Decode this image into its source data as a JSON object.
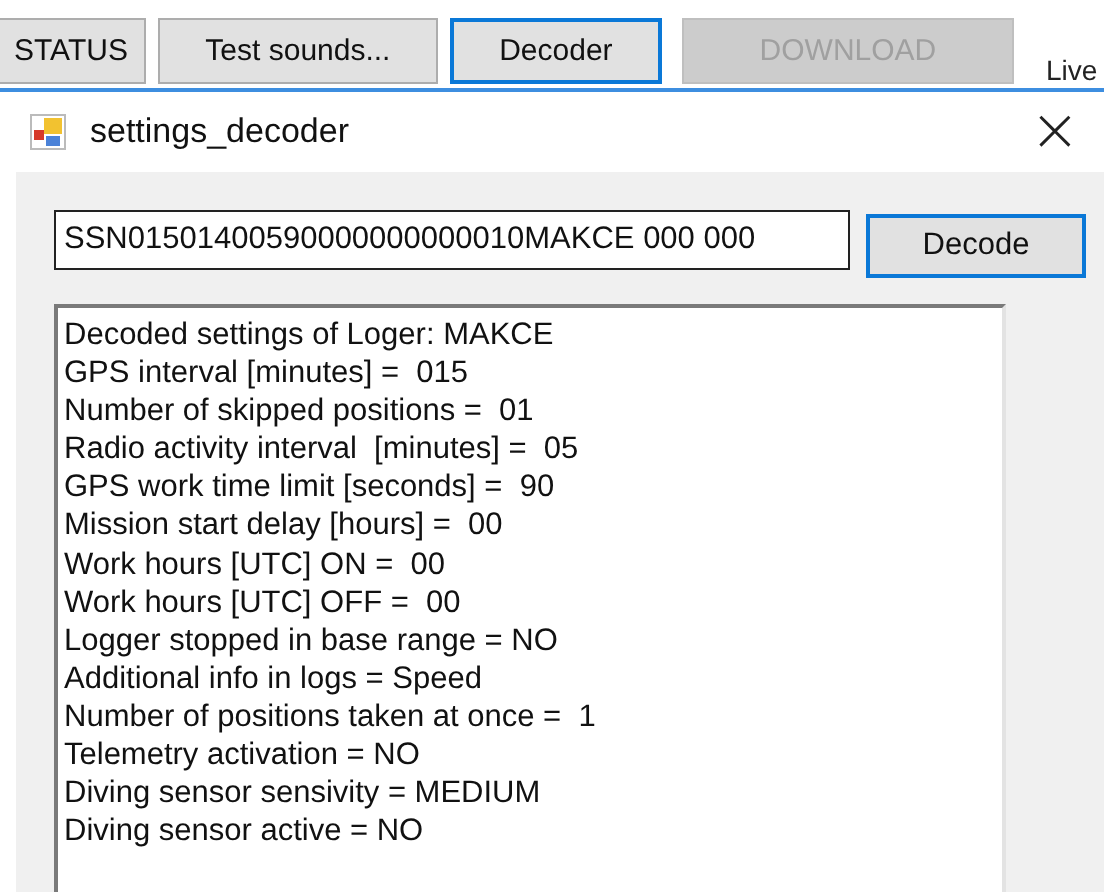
{
  "toolbar": {
    "buttons": [
      {
        "label": "STATUS",
        "disabled": false,
        "highlighted": false
      },
      {
        "label": "Test sounds...",
        "disabled": false,
        "highlighted": false
      },
      {
        "label": "Decoder",
        "disabled": false,
        "highlighted": true
      },
      {
        "label": "DOWNLOAD",
        "disabled": true,
        "highlighted": false
      }
    ],
    "side_label": "Live"
  },
  "dialog": {
    "title": "settings_decoder",
    "close": "×",
    "code_field": {
      "value": "SSN01501400590000000000010MAKCE 000 000"
    },
    "decode_button": {
      "label": "Decode",
      "highlighted": true
    },
    "output_lines": [
      "Decoded settings of Loger: MAKCE",
      "GPS interval [minutes] =  015",
      "Number of skipped positions =  01",
      "Radio activity interval  [minutes] =  05",
      "GPS work time limit [seconds] =  90",
      "Mission start delay [hours] =  00",
      "Work hours [UTC] ON =  00",
      "Work hours [UTC] OFF =  00",
      "Logger stopped in base range = NO",
      "Additional info in logs = Speed",
      "Number of positions taken at once =  1",
      "Telemetry activation = NO",
      "Diving sensor sensivity = MEDIUM",
      "Diving sensor active = NO"
    ]
  }
}
